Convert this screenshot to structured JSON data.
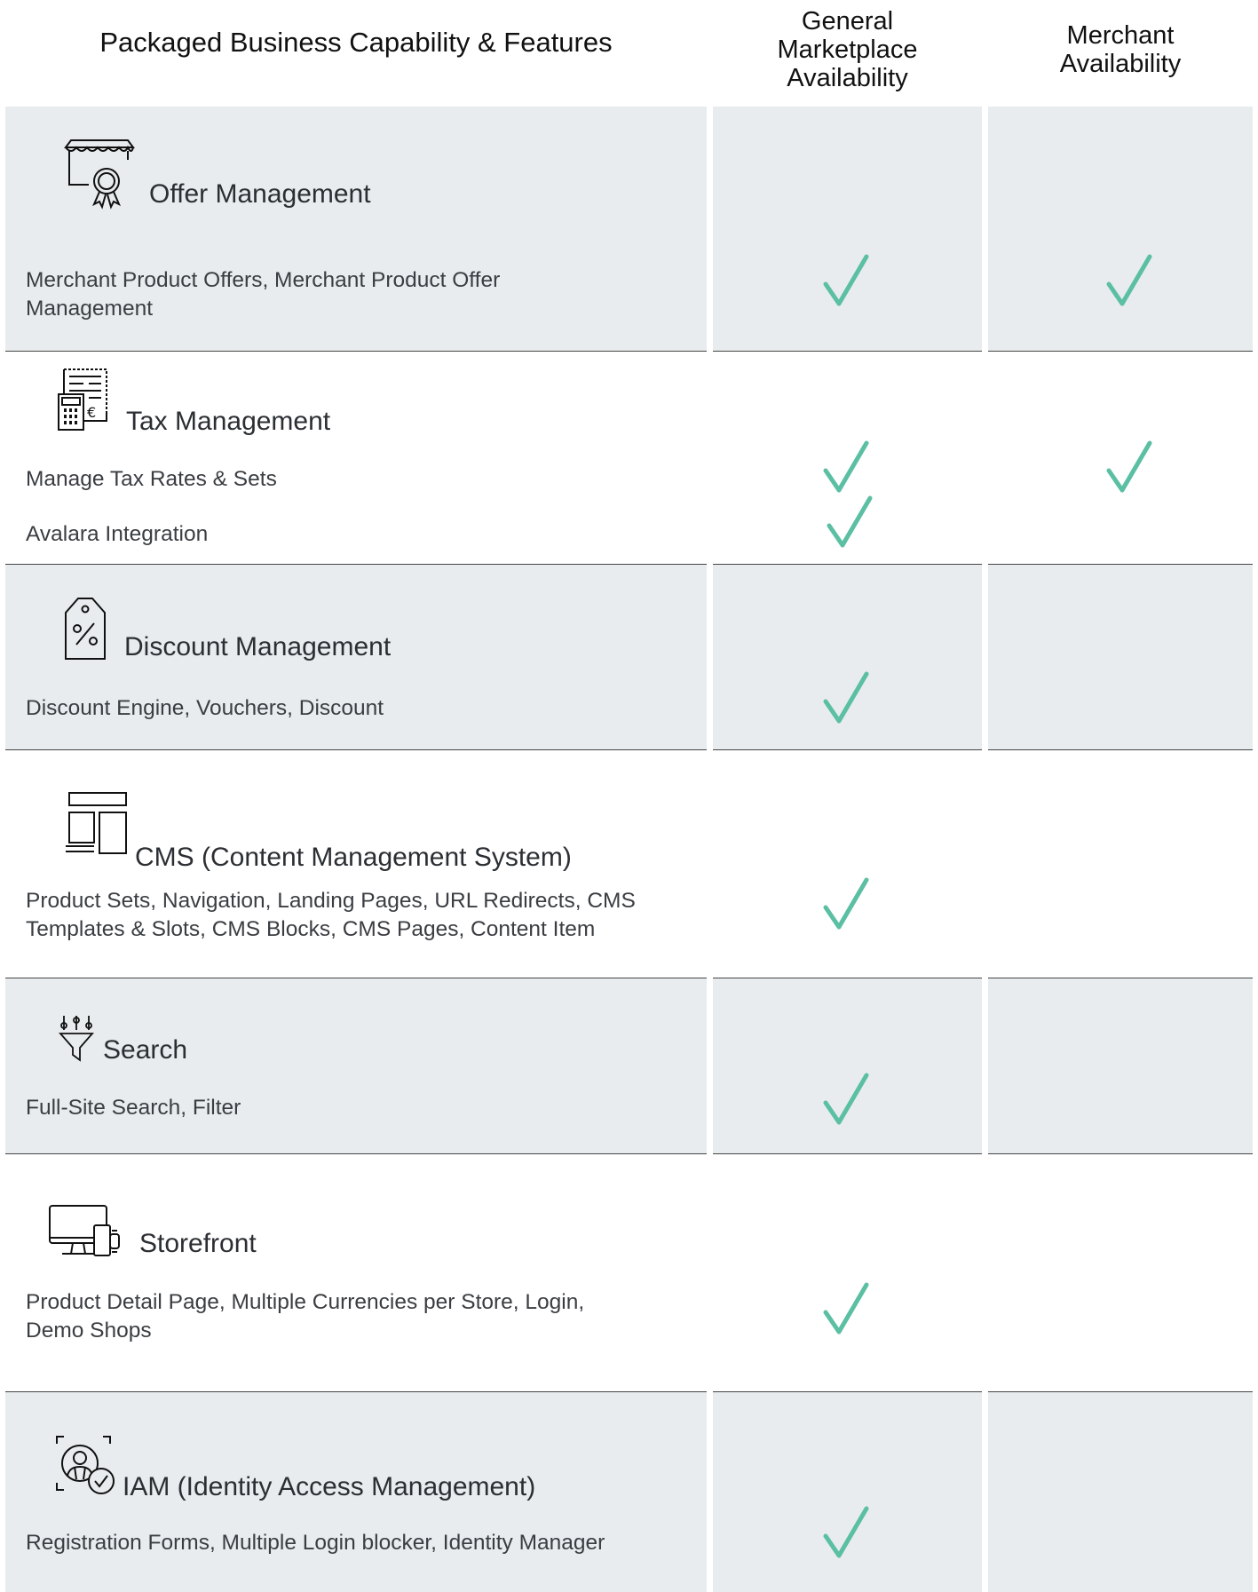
{
  "header": {
    "col1": "Packaged Business Capability & Features",
    "col2_lines": [
      "General",
      "Marketplace",
      "Availability"
    ],
    "col3_lines": [
      "Merchant",
      "Availability"
    ]
  },
  "colors": {
    "check": "#5bbfa3",
    "row_shade": "#e9ecee",
    "divider": "#444444"
  },
  "rows": [
    {
      "title": "Offer Management",
      "icon": "storefront-badge-icon",
      "features": [
        "Merchant Product Offers, Merchant Product Offer Management"
      ],
      "marketplace": [
        true
      ],
      "merchant": [
        true
      ]
    },
    {
      "title": "Tax Management",
      "icon": "tax-calculator-icon",
      "features": [
        "Manage Tax Rates & Sets",
        "Avalara Integration"
      ],
      "marketplace": [
        true,
        true
      ],
      "merchant": [
        true,
        false
      ]
    },
    {
      "title": "Discount Management",
      "icon": "discount-tag-icon",
      "features": [
        "Discount Engine, Vouchers, Discount"
      ],
      "marketplace": [
        true
      ],
      "merchant": [
        false
      ]
    },
    {
      "title": "CMS (Content Management System)",
      "icon": "layout-icon",
      "features": [
        "Product Sets, Navigation, Landing Pages, URL Redirects, CMS Templates & Slots, CMS Blocks, CMS Pages, Content Item"
      ],
      "marketplace": [
        true
      ],
      "merchant": [
        false
      ]
    },
    {
      "title": "Search",
      "icon": "filter-funnel-icon",
      "features": [
        "Full-Site Search, Filter"
      ],
      "marketplace": [
        true
      ],
      "merchant": [
        false
      ]
    },
    {
      "title": "Storefront",
      "icon": "devices-icon",
      "features": [
        "Product Detail Page, Multiple Currencies per Store, Login, Demo Shops"
      ],
      "marketplace": [
        true
      ],
      "merchant": [
        false
      ]
    },
    {
      "title": "IAM (Identity Access Management)",
      "icon": "identity-check-icon",
      "features": [
        "Registration Forms, Multiple Login blocker, Identity Manager"
      ],
      "marketplace": [
        true
      ],
      "merchant": [
        false
      ]
    }
  ]
}
